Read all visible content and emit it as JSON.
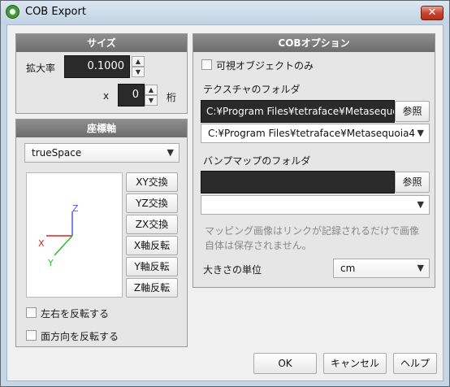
{
  "window": {
    "title": "COB Export",
    "close_glyph": "✕",
    "icon": "app-circle-icon"
  },
  "size_panel": {
    "header": "サイズ",
    "scale_label": "拡大率",
    "scale_value": "0.1000",
    "x_label": "x",
    "digits_value": "0",
    "digits_label": "桁"
  },
  "coord_panel": {
    "header": "座標軸",
    "system_selected": "trueSpace",
    "axis_labels": {
      "x": "X",
      "y": "Y",
      "z": "Z"
    },
    "axis_colors": {
      "x": "#e02020",
      "y": "#2fb82f",
      "z": "#4a5be0"
    },
    "buttons": [
      "XY交換",
      "YZ交換",
      "ZX交換",
      "X軸反転",
      "Y軸反転",
      "Z軸反転"
    ],
    "flip_lr_label": "左右を反転する",
    "flip_dir_label": "面方向を反転する"
  },
  "cob_panel": {
    "header": "COBオプション",
    "visible_only_label": "可視オブジェクトのみ",
    "texture_folder_label": "テクスチャのフォルダ",
    "texture_path": "C:¥Program Files¥tetraface¥Metasequoia",
    "browse_label": "参照",
    "texture_combo": "C:¥Program Files¥tetraface¥Metasequoia4",
    "bump_folder_label": "バンプマップのフォルダ",
    "bump_path": "",
    "bump_combo": "",
    "note_line1": "マッピング画像はリンクが記録されるだけで画像",
    "note_line2": "自体は保存されません。",
    "unit_label": "大きさの単位",
    "unit_value": "cm"
  },
  "footer": {
    "ok": "OK",
    "cancel": "キャンセル",
    "help": "ヘルプ"
  }
}
